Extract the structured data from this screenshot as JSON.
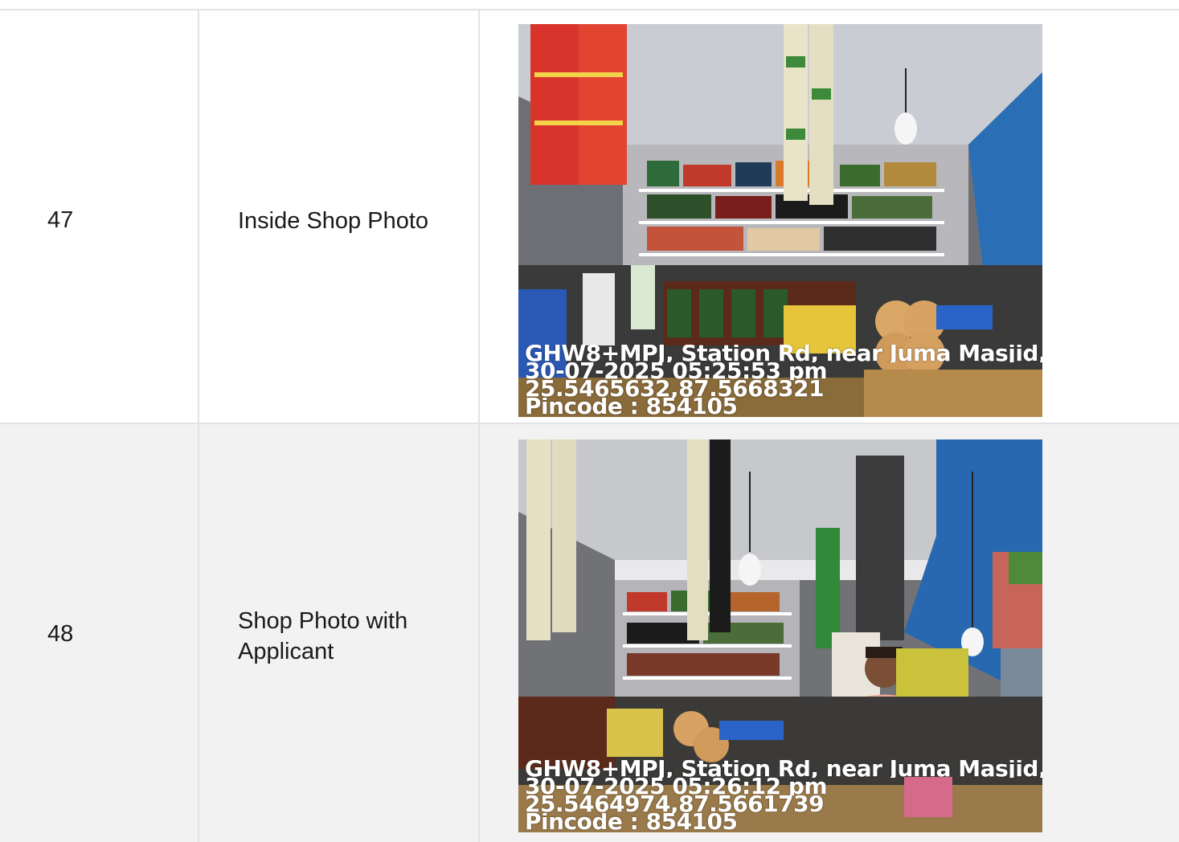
{
  "rows": [
    {
      "number": "47",
      "label": "Inside Shop Photo",
      "photo": {
        "subject": "shop interior with shelves of products and hanging sachet strips",
        "stamp": {
          "address": "GHW8+MPJ, Station Rd, near Juma Masjid, .",
          "datetime": "30-07-2025 05:25:53 pm",
          "coords": "25.5465632,87.5668321",
          "pincode": "Pincode : 854105"
        }
      }
    },
    {
      "number": "48",
      "label": "Shop Photo with Applicant",
      "photo": {
        "subject": "shop front with applicant standing behind counter",
        "stamp": {
          "address": "GHW8+MPJ, Station Rd, near Juma Masjid, .",
          "datetime": "30-07-2025 05:26:12 pm",
          "coords": "25.5464974,87.5661739",
          "pincode": "Pincode : 854105"
        }
      }
    }
  ],
  "colors": {
    "border": "#e2e2e2",
    "row_alt": "#f2f2f2",
    "text": "#1a1a1a"
  }
}
